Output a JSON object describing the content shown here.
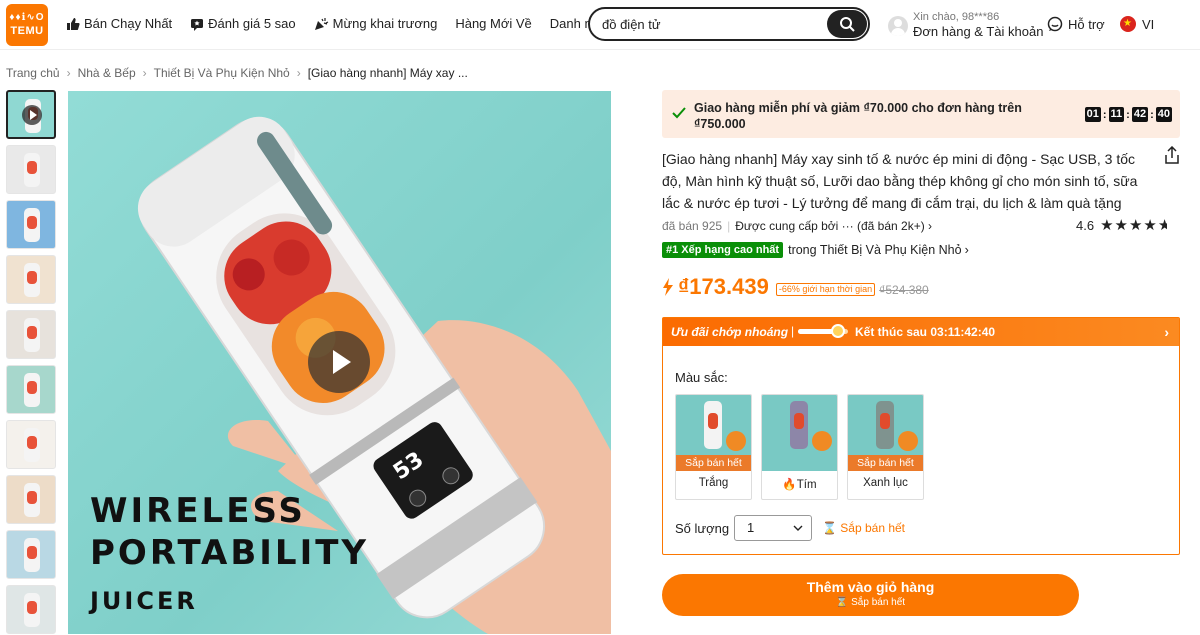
{
  "logo": {
    "line1": "♦♦ℹ∿O",
    "line2": "TEMU"
  },
  "nav": [
    {
      "label": "Bán Chạy Nhất",
      "icon": "thumbs-up-icon"
    },
    {
      "label": "Đánh giá 5 sao",
      "icon": "star-review-icon"
    },
    {
      "label": "Mừng khai trương",
      "icon": "party-popper-icon"
    },
    {
      "label": "Hàng Mới Về",
      "icon": ""
    },
    {
      "label": "Danh mục",
      "icon": "chevron-down-icon"
    }
  ],
  "search": {
    "value": "đồ điện tử",
    "placeholder": ""
  },
  "account": {
    "greeting": "Xin chào, 98***86",
    "orders": "Đơn hàng & Tài khoản"
  },
  "support": {
    "label": "Hỗ trợ"
  },
  "language": {
    "label": "VI"
  },
  "breadcrumb": [
    "Trang chủ",
    "Nhà & Bếp",
    "Thiết Bị Và Phụ Kiện Nhỏ",
    "[Giao hàng nhanh] Máy xay ..."
  ],
  "gallery": {
    "thumb_count": 10,
    "image_text": [
      "WIRELESS",
      "PORTABILITY",
      "JUICER"
    ],
    "screen_digits": "53"
  },
  "shipping": {
    "text": "Giao hàng miễn phí và giảm ₫70.000 cho đơn hàng trên ₫750.000",
    "timer": [
      "01",
      "11",
      "42",
      "40"
    ]
  },
  "product": {
    "title": "[Giao hàng nhanh] Máy xay sinh tố & nước ép mini di động - Sạc USB, 3 tốc độ, Màn hình kỹ thuật số, Lưỡi dao bằng thép không gỉ cho món sinh tố, sữa lắc & nước ép tươi - Lý tưởng để mang đi cắm trại, du lịch & làm quà tặng",
    "sold": "đã bán 925",
    "supplier": "Được cung cấp bởi ··· (đã bán 2k+)",
    "rating": "4.6",
    "rank_badge": "#1 Xếp hạng cao nhất",
    "rank_text": "trong Thiết Bị Và Phụ Kiện Nhỏ",
    "price": "₫173.439",
    "discount": "-66% giới hạn thời gian",
    "old_price": "₫524.380"
  },
  "flash_sale": {
    "title": "Ưu đãi chớp nhoáng",
    "ends": "Kết thúc sau 03:11:42:40"
  },
  "options": {
    "color_label": "Màu sắc:",
    "colors": [
      {
        "name": "Trắng",
        "status": "Sắp bán hết",
        "jar_color": "#f3f3f3"
      },
      {
        "name": "Tím",
        "status": "",
        "jar_color": "#8d86a8"
      },
      {
        "name": "Xanh lục",
        "status": "Sắp bán hết",
        "jar_color": "#7f938f"
      }
    ],
    "quantity_label": "Số lượng",
    "quantity_value": "1",
    "quantity_status": "Sắp bán hết"
  },
  "cart": {
    "button": "Thêm vào giỏ hàng",
    "sub": "Sắp bán hết"
  },
  "colors": {
    "accent": "#fb7701",
    "rank_green": "#0a8f08",
    "banner_bg": "#fdece1"
  }
}
